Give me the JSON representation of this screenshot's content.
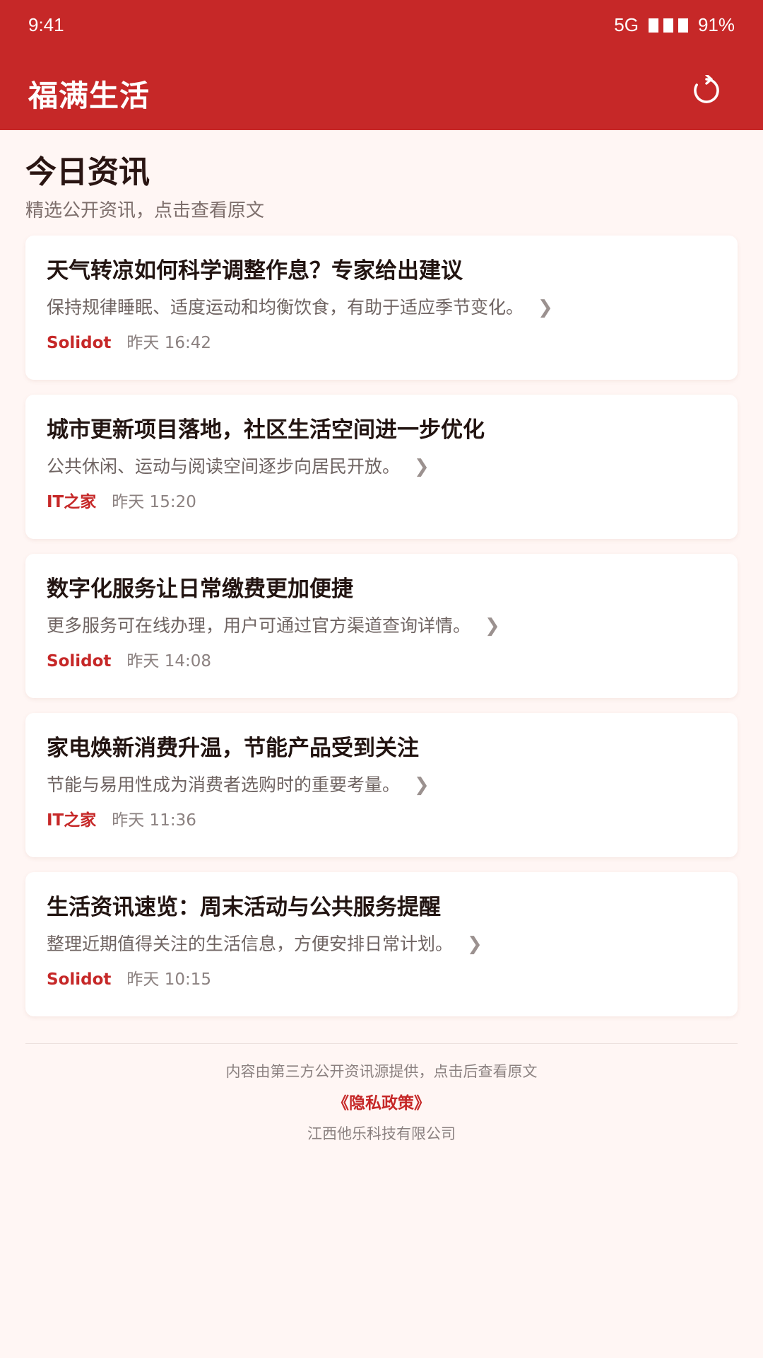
{
  "status_bar": {
    "time": "9:41",
    "network": "5G",
    "battery": "91%"
  },
  "app_bar": {
    "title": "福满生活",
    "refresh_icon": "refresh-icon"
  },
  "section": {
    "title": "今日资讯",
    "subtitle": "精选公开资讯，点击查看原文"
  },
  "news": [
    {
      "title": "天气转凉如何科学调整作息？专家给出建议",
      "summary": "保持规律睡眠、适度运动和均衡饮食，有助于适应季节变化。",
      "source": "Solidot",
      "time": "昨天 16:42"
    },
    {
      "title": "城市更新项目落地，社区生活空间进一步优化",
      "summary": "公共休闲、运动与阅读空间逐步向居民开放。",
      "source": "IT之家",
      "time": "昨天 15:20"
    },
    {
      "title": "数字化服务让日常缴费更加便捷",
      "summary": "更多服务可在线办理，用户可通过官方渠道查询详情。",
      "source": "Solidot",
      "time": "昨天 14:08"
    },
    {
      "title": "家电焕新消费升温，节能产品受到关注",
      "summary": "节能与易用性成为消费者选购时的重要考量。",
      "source": "IT之家",
      "time": "昨天 11:36"
    },
    {
      "title": "生活资讯速览：周末活动与公共服务提醒",
      "summary": "整理近期值得关注的生活信息，方便安排日常计划。",
      "source": "Solidot",
      "time": "昨天 10:15"
    }
  ],
  "footer": {
    "note": "内容由第三方公开资讯源提供，点击后查看原文",
    "privacy": "《隐私政策》",
    "company": "江西他乐科技有限公司"
  },
  "colors": {
    "primary": "#c62828",
    "background": "#fff6f4"
  }
}
